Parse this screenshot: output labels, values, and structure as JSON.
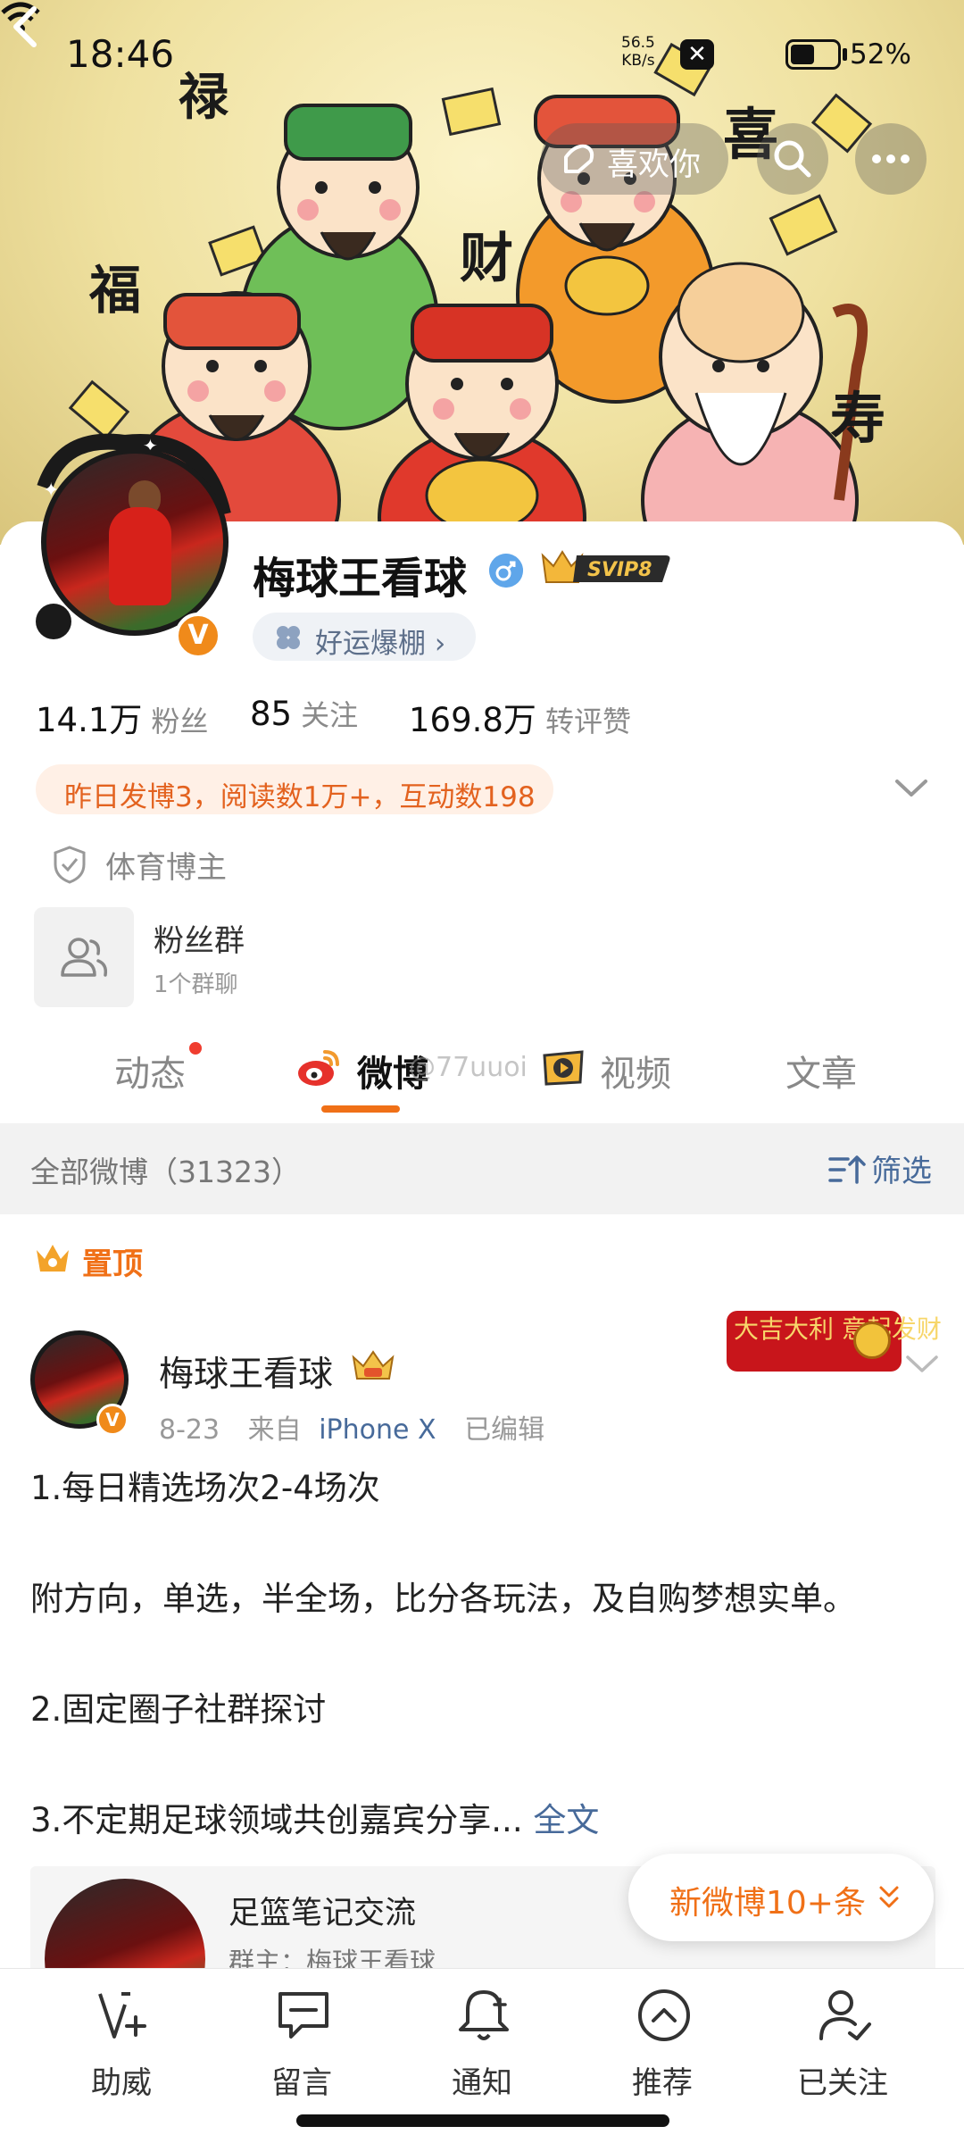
{
  "status_bar": {
    "time": "18:46",
    "net_speed_value": "56.5",
    "net_speed_unit": "KB/s",
    "battery_percent": "52%",
    "battery_level": 0.52
  },
  "top_nav": {
    "like_label": "喜欢你",
    "banner_characters": [
      "禄",
      "福",
      "财",
      "喜",
      "寿"
    ]
  },
  "profile": {
    "name": "梅球王看球",
    "vip_badge": "SVIP8",
    "verified_mark": "V",
    "luck_label": "好运爆棚",
    "stats": [
      {
        "value": "14.1万",
        "label": "粉丝"
      },
      {
        "value": "85",
        "label": "关注"
      },
      {
        "value": "169.8万",
        "label": "转评赞"
      }
    ],
    "daily_summary": "昨日发博3，阅读数1万+，互动数198",
    "category": "体育博主",
    "fan_group": {
      "title": "粉丝群",
      "subtitle": "1个群聊"
    }
  },
  "tabs": [
    {
      "label": "动态"
    },
    {
      "label": "微博"
    },
    {
      "label": "视频"
    },
    {
      "label": "文章"
    }
  ],
  "watermark": "@77uuoi",
  "filter_bar": {
    "all_label": "全部微博（31323）",
    "filter_label": "筛选"
  },
  "pinned_label": "置顶",
  "post": {
    "author": "梅球王看球",
    "date": "8-23",
    "source_prefix": "来自",
    "device": "iPhone X",
    "edited": "已编辑",
    "badge_text": "大吉大利 意起发财",
    "lines": [
      "1.每日精选场次2-4场次",
      "附方向，单选，半全场，比分各玩法，及自购梦想实单。",
      "2.固定圈子社群探讨",
      "3.不定期足球领域共创嘉宾分享..."
    ],
    "full_text_link": "全文",
    "group_card": {
      "title": "足篮笔记交流",
      "subtitle": "群主：梅球王看球"
    }
  },
  "new_posts_label": "新微博10+条",
  "bottom_bar": [
    {
      "label": "助威",
      "icon": "cheer-icon"
    },
    {
      "label": "留言",
      "icon": "message-icon"
    },
    {
      "label": "通知",
      "icon": "bell-plus-icon"
    },
    {
      "label": "推荐",
      "icon": "recommend-icon"
    },
    {
      "label": "已关注",
      "icon": "followed-icon"
    }
  ],
  "colors": {
    "accent_orange": "#f07017",
    "link_blue": "#476a9a",
    "notification_red": "#f03d2f"
  }
}
